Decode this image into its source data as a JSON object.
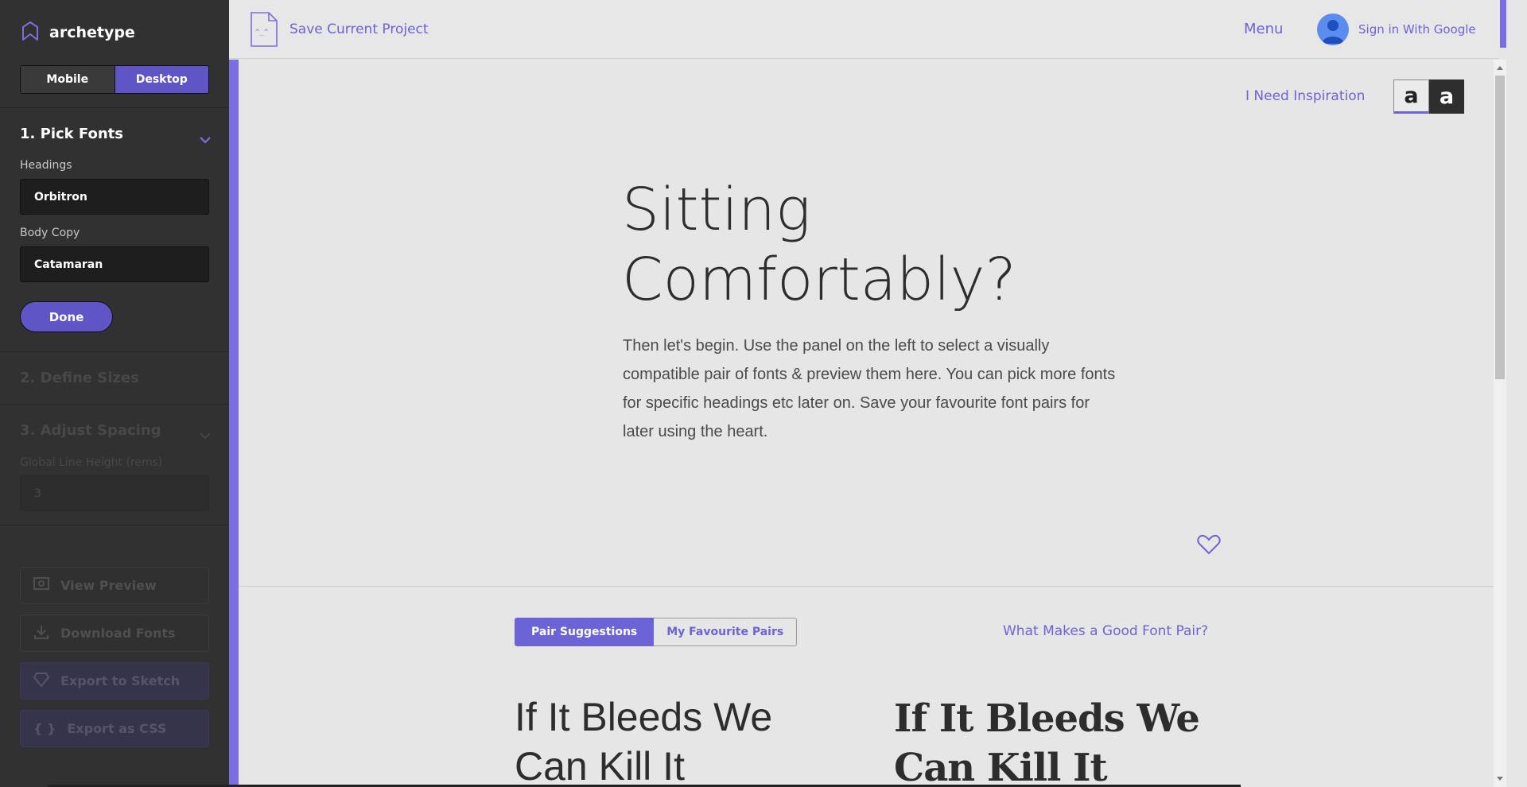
{
  "brand": {
    "name": "archetype"
  },
  "device_toggle": {
    "mobile": "Mobile",
    "desktop": "Desktop",
    "selected": "Desktop"
  },
  "steps": {
    "pick_fonts": {
      "title": "1. Pick Fonts",
      "headings_label": "Headings",
      "headings_value": "Orbitron",
      "body_label": "Body Copy",
      "body_value": "Catamaran",
      "done": "Done"
    },
    "define_sizes": {
      "title": "2. Define Sizes"
    },
    "adjust_spacing": {
      "title": "3. Adjust Spacing",
      "line_height_label": "Global Line Height (rems)",
      "line_height_value": "3"
    }
  },
  "actions": {
    "view_preview": "View Preview",
    "download_fonts": "Download Fonts",
    "export_sketch": "Export to Sketch",
    "export_css": "Export as CSS",
    "css_glyph": "{ }"
  },
  "topbar": {
    "save_project": "Save Current Project",
    "file_icon_text": "^_^",
    "menu": "Menu",
    "sign_in": "Sign in With Google"
  },
  "preview": {
    "inspiration": "I Need Inspiration",
    "theme_light": "a",
    "theme_dark": "a",
    "heading": "Sitting Comfortably?",
    "body": "Then let's begin. Use the panel on the left to select a visually compatible pair of fonts & preview them here. You can pick more fonts for specific headings etc later on. Save your favourite font pairs for later using the heart."
  },
  "pairs": {
    "tab_suggestions": "Pair Suggestions",
    "tab_favourites": "My Favourite Pairs",
    "active_tab": "Pair Suggestions",
    "good_pair_link": "What Makes a Good Font Pair?",
    "sample_1": "If It Bleeds We Can Kill It",
    "sample_2": "If It Bleeds We Can Kill It"
  },
  "colors": {
    "accent": "#6c63d6",
    "sidebar_bg": "#313131",
    "content_bg": "#e6e6e6",
    "text_dark": "#2d2d2d"
  }
}
